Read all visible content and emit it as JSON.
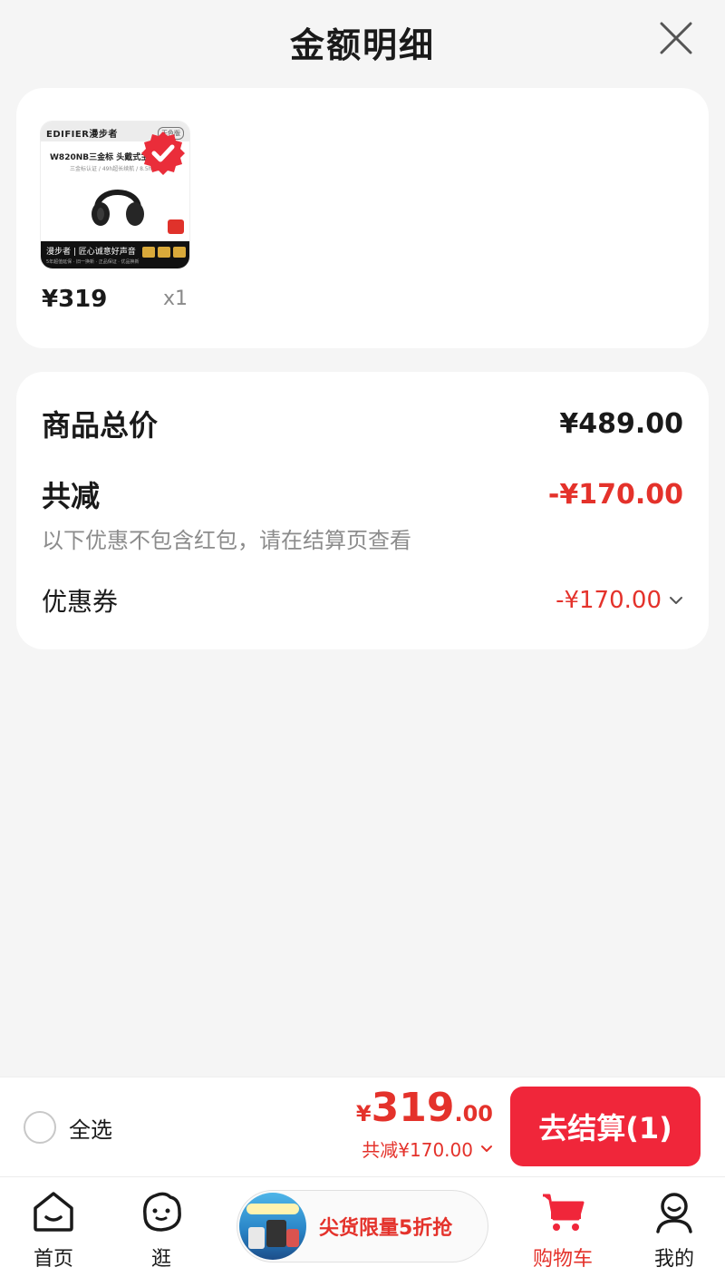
{
  "header": {
    "title": "金额明细"
  },
  "product": {
    "thumb": {
      "brand": "EDIFIER漫步者",
      "tag": "无色版",
      "line1": "W820NB三金标 头戴式主动降",
      "line2": "三金标认证 / 49h超长续航 / 8.5h持久续航",
      "bottom_text": "漫步者 | 匠心诚意好声音",
      "bottom_sub": "5年超值延保 · 旧一换新 · 正品保证 · 优品换新"
    },
    "price": "¥319",
    "quantity": "x1"
  },
  "summary": {
    "total_label": "商品总价",
    "total_value": "¥489.00",
    "reduce_label": "共减",
    "reduce_value": "-¥170.00",
    "note": "以下优惠不包含红包，请在结算页查看",
    "coupon_label": "优惠券",
    "coupon_value": "-¥170.00"
  },
  "checkout": {
    "select_all_label": "全选",
    "price_symbol": "¥",
    "price_integer": "319",
    "price_decimal": ".00",
    "reduce_text": "共减¥170.00",
    "button_label": "去结算(1)"
  },
  "nav": {
    "items": [
      {
        "label": "首页",
        "icon": "home-icon"
      },
      {
        "label": "逛",
        "icon": "browse-face-icon"
      },
      {
        "label": "购物车",
        "icon": "cart-icon",
        "active": true
      },
      {
        "label": "我的",
        "icon": "profile-icon"
      }
    ],
    "promo_text": "尖货限量5折抢"
  },
  "colors": {
    "accent_red": "#e4322b",
    "button_red": "#f0263a",
    "background": "#f5f5f5",
    "card": "#ffffff",
    "muted_text": "#8c8c8c"
  }
}
